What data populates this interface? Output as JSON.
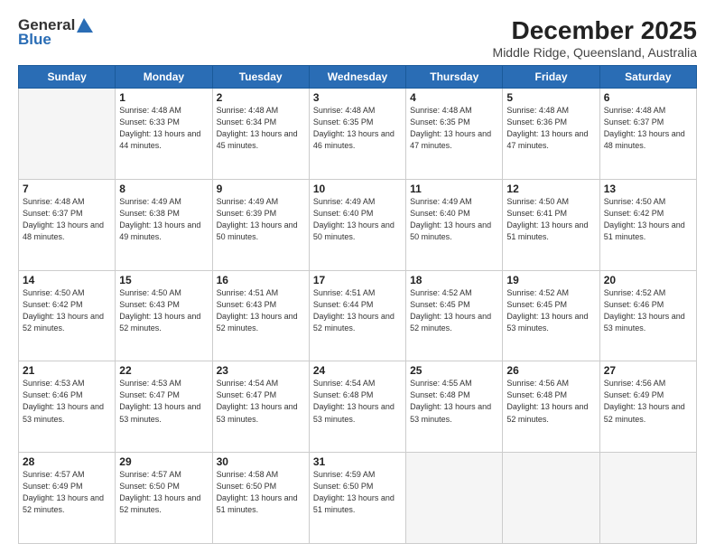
{
  "header": {
    "logo_general": "General",
    "logo_blue": "Blue",
    "title": "December 2025",
    "subtitle": "Middle Ridge, Queensland, Australia"
  },
  "days_of_week": [
    "Sunday",
    "Monday",
    "Tuesday",
    "Wednesday",
    "Thursday",
    "Friday",
    "Saturday"
  ],
  "weeks": [
    [
      {
        "day": "",
        "empty": true
      },
      {
        "day": "1",
        "rise": "4:48 AM",
        "set": "6:33 PM",
        "daylight": "13 hours and 44 minutes."
      },
      {
        "day": "2",
        "rise": "4:48 AM",
        "set": "6:34 PM",
        "daylight": "13 hours and 45 minutes."
      },
      {
        "day": "3",
        "rise": "4:48 AM",
        "set": "6:35 PM",
        "daylight": "13 hours and 46 minutes."
      },
      {
        "day": "4",
        "rise": "4:48 AM",
        "set": "6:35 PM",
        "daylight": "13 hours and 47 minutes."
      },
      {
        "day": "5",
        "rise": "4:48 AM",
        "set": "6:36 PM",
        "daylight": "13 hours and 47 minutes."
      },
      {
        "day": "6",
        "rise": "4:48 AM",
        "set": "6:37 PM",
        "daylight": "13 hours and 48 minutes."
      }
    ],
    [
      {
        "day": "7",
        "rise": "4:48 AM",
        "set": "6:37 PM",
        "daylight": "13 hours and 48 minutes."
      },
      {
        "day": "8",
        "rise": "4:49 AM",
        "set": "6:38 PM",
        "daylight": "13 hours and 49 minutes."
      },
      {
        "day": "9",
        "rise": "4:49 AM",
        "set": "6:39 PM",
        "daylight": "13 hours and 50 minutes."
      },
      {
        "day": "10",
        "rise": "4:49 AM",
        "set": "6:40 PM",
        "daylight": "13 hours and 50 minutes."
      },
      {
        "day": "11",
        "rise": "4:49 AM",
        "set": "6:40 PM",
        "daylight": "13 hours and 50 minutes."
      },
      {
        "day": "12",
        "rise": "4:50 AM",
        "set": "6:41 PM",
        "daylight": "13 hours and 51 minutes."
      },
      {
        "day": "13",
        "rise": "4:50 AM",
        "set": "6:42 PM",
        "daylight": "13 hours and 51 minutes."
      }
    ],
    [
      {
        "day": "14",
        "rise": "4:50 AM",
        "set": "6:42 PM",
        "daylight": "13 hours and 52 minutes."
      },
      {
        "day": "15",
        "rise": "4:50 AM",
        "set": "6:43 PM",
        "daylight": "13 hours and 52 minutes."
      },
      {
        "day": "16",
        "rise": "4:51 AM",
        "set": "6:43 PM",
        "daylight": "13 hours and 52 minutes."
      },
      {
        "day": "17",
        "rise": "4:51 AM",
        "set": "6:44 PM",
        "daylight": "13 hours and 52 minutes."
      },
      {
        "day": "18",
        "rise": "4:52 AM",
        "set": "6:45 PM",
        "daylight": "13 hours and 52 minutes."
      },
      {
        "day": "19",
        "rise": "4:52 AM",
        "set": "6:45 PM",
        "daylight": "13 hours and 53 minutes."
      },
      {
        "day": "20",
        "rise": "4:52 AM",
        "set": "6:46 PM",
        "daylight": "13 hours and 53 minutes."
      }
    ],
    [
      {
        "day": "21",
        "rise": "4:53 AM",
        "set": "6:46 PM",
        "daylight": "13 hours and 53 minutes."
      },
      {
        "day": "22",
        "rise": "4:53 AM",
        "set": "6:47 PM",
        "daylight": "13 hours and 53 minutes."
      },
      {
        "day": "23",
        "rise": "4:54 AM",
        "set": "6:47 PM",
        "daylight": "13 hours and 53 minutes."
      },
      {
        "day": "24",
        "rise": "4:54 AM",
        "set": "6:48 PM",
        "daylight": "13 hours and 53 minutes."
      },
      {
        "day": "25",
        "rise": "4:55 AM",
        "set": "6:48 PM",
        "daylight": "13 hours and 53 minutes."
      },
      {
        "day": "26",
        "rise": "4:56 AM",
        "set": "6:48 PM",
        "daylight": "13 hours and 52 minutes."
      },
      {
        "day": "27",
        "rise": "4:56 AM",
        "set": "6:49 PM",
        "daylight": "13 hours and 52 minutes."
      }
    ],
    [
      {
        "day": "28",
        "rise": "4:57 AM",
        "set": "6:49 PM",
        "daylight": "13 hours and 52 minutes."
      },
      {
        "day": "29",
        "rise": "4:57 AM",
        "set": "6:50 PM",
        "daylight": "13 hours and 52 minutes."
      },
      {
        "day": "30",
        "rise": "4:58 AM",
        "set": "6:50 PM",
        "daylight": "13 hours and 51 minutes."
      },
      {
        "day": "31",
        "rise": "4:59 AM",
        "set": "6:50 PM",
        "daylight": "13 hours and 51 minutes."
      },
      {
        "day": "",
        "empty": true
      },
      {
        "day": "",
        "empty": true
      },
      {
        "day": "",
        "empty": true
      }
    ]
  ]
}
